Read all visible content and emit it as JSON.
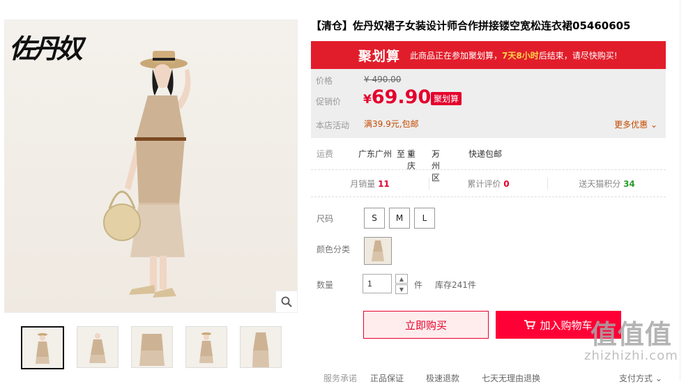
{
  "brand": {
    "logo_text": "佐丹奴"
  },
  "gallery": {
    "thumbnails": [
      "thumb-1",
      "thumb-2",
      "thumb-3",
      "thumb-4",
      "thumb-5"
    ],
    "active_index": 0
  },
  "product": {
    "title": "【清仓】佐丹奴裙子女装设计师合作拼接镂空宽松连衣裙05460605"
  },
  "juhuasuan": {
    "logo": "聚划算",
    "text_before": "此商品正在参加聚划算，",
    "highlight": "7天8小时",
    "text_after": "后结束，请尽快购买!"
  },
  "price": {
    "price_label": "价格",
    "original": "¥ 490.00",
    "promo_label": "促销价",
    "promo_currency": "¥",
    "promo_value": "69.90",
    "promo_tag": "聚划算",
    "activity_label": "本店活动",
    "activity_text": "满39.9元,包邮",
    "more_label": "更多优惠"
  },
  "shipping": {
    "label": "运费",
    "from": "广东广州",
    "to_prefix": "至",
    "province": "重庆",
    "district": "万州区",
    "method": "快递包邮"
  },
  "stats": [
    {
      "label": "月销量",
      "value": "11",
      "color": "red"
    },
    {
      "label": "累计评价",
      "value": "0",
      "color": "red"
    },
    {
      "label": "送天猫积分",
      "value": "34",
      "color": "green"
    }
  ],
  "options": {
    "size_label": "尺码",
    "sizes": [
      "S",
      "M",
      "L"
    ],
    "color_label": "颜色分类",
    "qty_label": "数量",
    "qty_value": "1",
    "qty_unit": "件",
    "stock": "库存241件"
  },
  "actions": {
    "buy_now": "立即购买",
    "add_cart": "加入购物车"
  },
  "service": {
    "label": "服务承诺",
    "items": [
      "正品保证",
      "极速退款",
      "七天无理由退换"
    ],
    "payment": "支付方式"
  },
  "watermark": {
    "big": "值值值",
    "small": "zhizhizhi.com"
  },
  "colors": {
    "accent": "#e5002d",
    "juhuasuan_bg": "#e21d2b",
    "cart_bg": "#ff0036"
  }
}
